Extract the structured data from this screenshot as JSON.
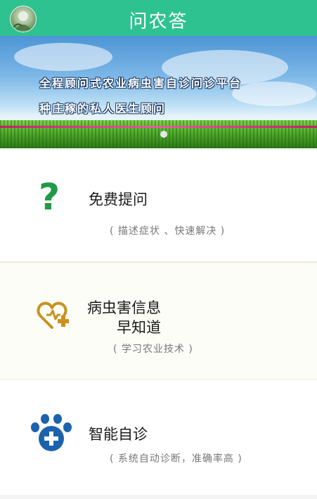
{
  "header": {
    "title": "问农答",
    "avatar_icon": "user-avatar",
    "bg_color": "#2ec290"
  },
  "banner": {
    "line1": "全程顾问式农业病虫害自诊问诊平台",
    "line2": "种庄稼的私人医生顾问"
  },
  "cards": [
    {
      "icon": "question-mark-icon",
      "title": "免费提问",
      "subtitle": "( 描述症状 、快速解决 )",
      "icon_color": "#1f9a46"
    },
    {
      "icon": "heart-plus-icon",
      "title_line1": "病虫害信息",
      "title_line2": "早知道",
      "subtitle": "( 学习农业技术 )",
      "icon_color": "#c8921f"
    },
    {
      "icon": "paw-plus-icon",
      "title": "智能自诊",
      "subtitle": "( 系统自动诊断，准确率高 )",
      "icon_color": "#1c63ad"
    }
  ]
}
